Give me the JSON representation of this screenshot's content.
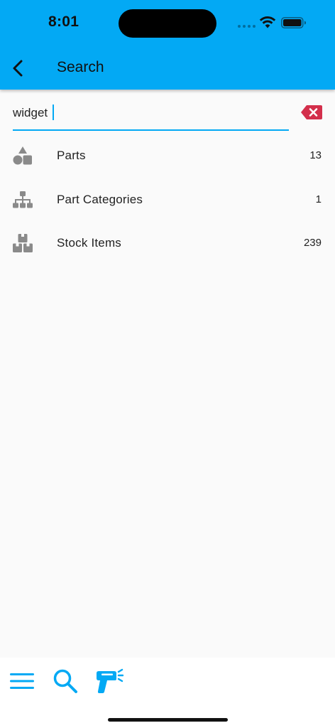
{
  "status_bar": {
    "time": "8:01"
  },
  "header": {
    "title": "Search",
    "back_icon": "chevron-left-icon",
    "background": "#03A9F4"
  },
  "search": {
    "value": "widget",
    "clear_icon": "backspace-icon",
    "clear_icon_color": "#D32F4B",
    "underline_color": "#03A9F4"
  },
  "results": [
    {
      "label": "Parts",
      "count": "13",
      "icon": "shapes-icon"
    },
    {
      "label": "Part Categories",
      "count": "1",
      "icon": "sitemap-icon"
    },
    {
      "label": "Stock Items",
      "count": "239",
      "icon": "boxes-icon"
    }
  ],
  "bottom_nav": {
    "items": [
      {
        "icon": "menu-icon"
      },
      {
        "icon": "search-icon"
      },
      {
        "icon": "barcode-scanner-icon"
      }
    ],
    "accent_color": "#03A9F4"
  },
  "colors": {
    "icon_gray": "#8A8A8A",
    "background": "#FAFAFA"
  }
}
